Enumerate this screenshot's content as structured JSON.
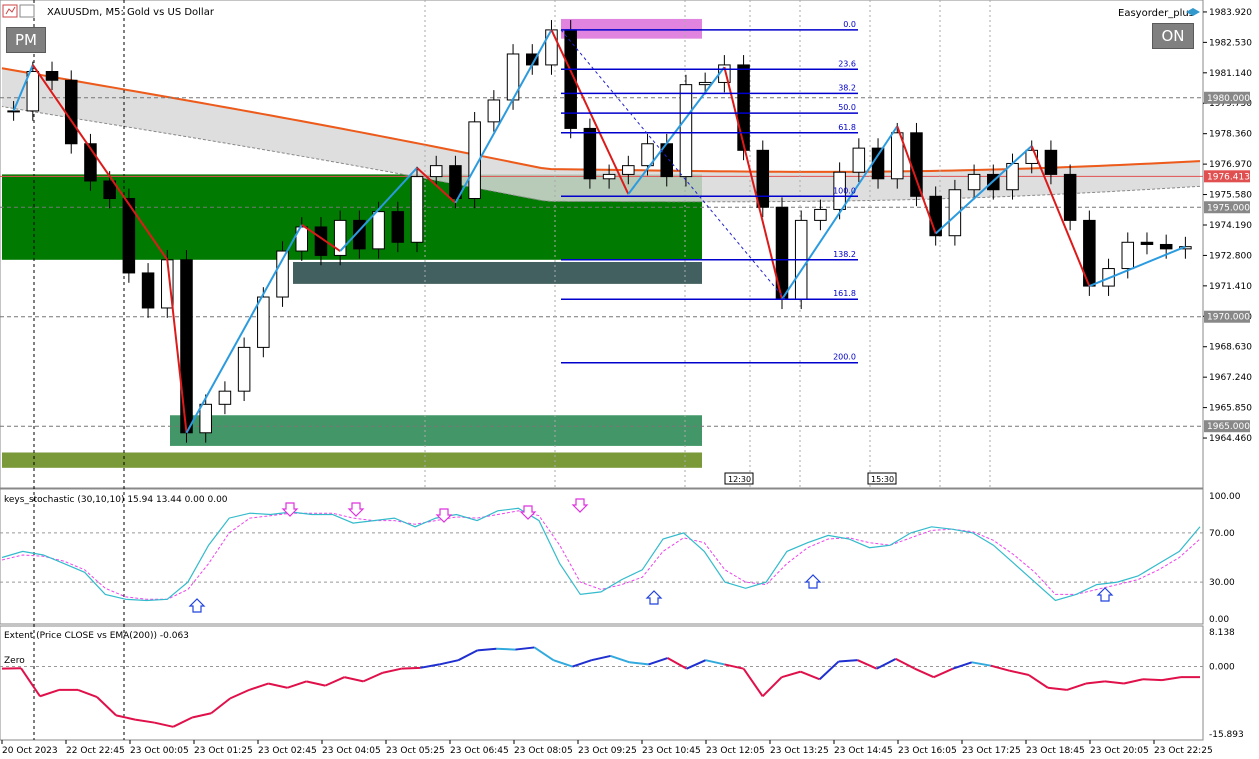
{
  "header": {
    "title": "XAUUSDm, M5:  Gold vs US Dollar",
    "ea_name": "Easyorder_plus"
  },
  "buttons": {
    "pm": "PM",
    "on": "ON"
  },
  "panels": {
    "stochastic_label": "keys_stochastic (30,10,10) 15.94 13.44 0.00 0.00",
    "extent_label": "Extent (Price CLOSE vs EMA(200)) -0.063",
    "zero_label": "Zero"
  },
  "chart_data": [
    {
      "type": "candlestick",
      "title": "XAUUSDm, M5:  Gold vs US Dollar",
      "ylim": [
        1963.0,
        1984.1
      ],
      "y_ticks": [
        "1983.920",
        "1982.530",
        "1981.140",
        "1979.750",
        "1978.360",
        "1976.970",
        "1975.580",
        "1974.190",
        "1972.800",
        "1971.410",
        "1970.020",
        "1968.630",
        "1967.240",
        "1965.850",
        "1964.460"
      ],
      "price_tags": [
        {
          "label": "1980.000",
          "value": 1980.0
        },
        {
          "label": "1976.413",
          "value": 1976.413,
          "color": "#e05050"
        },
        {
          "label": "1975.000",
          "value": 1975.0
        },
        {
          "label": "1970.000",
          "value": 1970.0
        },
        {
          "label": "1965.000",
          "value": 1965.0
        }
      ],
      "x_ticks": [
        "20 Oct 2023",
        "22 Oct 22:45",
        "23 Oct 00:05",
        "23 Oct 01:25",
        "23 Oct 02:45",
        "23 Oct 04:05",
        "23 Oct 05:25",
        "23 Oct 06:45",
        "23 Oct 08:05",
        "23 Oct 09:25",
        "23 Oct 10:45",
        "23 Oct 12:05",
        "23 Oct 13:25",
        "23 Oct 14:45",
        "23 Oct 16:05",
        "23 Oct 17:25",
        "23 Oct 18:45",
        "23 Oct 20:05",
        "23 Oct 22:25"
      ],
      "time_markers": [
        "12:30",
        "15:30"
      ],
      "fibonacci": [
        {
          "level": "0.0",
          "price": 1983.1
        },
        {
          "level": "23.6",
          "price": 1981.3
        },
        {
          "level": "38.2",
          "price": 1980.2
        },
        {
          "level": "50.0",
          "price": 1979.3
        },
        {
          "level": "61.8",
          "price": 1978.4
        },
        {
          "level": "100.0",
          "price": 1975.5
        },
        {
          "level": "138.2",
          "price": 1972.6
        },
        {
          "level": "161.8",
          "price": 1970.8
        },
        {
          "level": "200.0",
          "price": 1967.9
        }
      ],
      "zones": [
        {
          "name": "supply-zone",
          "from": 1982.7,
          "to": 1983.6,
          "color": "#dd77dd"
        },
        {
          "name": "demand-zone-main",
          "from": 1972.6,
          "to": 1976.5,
          "color": "#007a00"
        },
        {
          "name": "gap-zone",
          "from": 1971.5,
          "to": 1972.5,
          "color": "#2f4f4f"
        },
        {
          "name": "demand-zone-low",
          "from": 1964.1,
          "to": 1965.5,
          "color": "#2e8b57"
        },
        {
          "name": "base-zone",
          "from": 1963.1,
          "to": 1963.8,
          "color": "#6b8e23"
        }
      ],
      "series": [
        {
          "name": "close",
          "values": [
            1979.4,
            1981.2,
            1980.8,
            1977.9,
            1976.2,
            1975.4,
            1972.0,
            1970.4,
            1972.6,
            1964.7,
            1966.0,
            1966.6,
            1968.6,
            1970.9,
            1973.0,
            1974.1,
            1972.8,
            1974.4,
            1973.1,
            1974.8,
            1973.4,
            1976.4,
            1976.9,
            1975.4,
            1978.9,
            1979.9,
            1982.0,
            1981.5,
            1983.1,
            1978.6,
            1976.3,
            1976.5,
            1976.9,
            1977.9,
            1976.4,
            1980.6,
            1980.7,
            1981.5,
            1977.6,
            1975.0,
            1970.8,
            1974.4,
            1974.9,
            1976.6,
            1977.7,
            1976.3,
            1978.4,
            1975.5,
            1973.7,
            1975.8,
            1976.5,
            1975.8,
            1977.0,
            1977.6,
            1976.5,
            1974.4,
            1971.4,
            1972.2,
            1973.4,
            1973.3,
            1973.1,
            1973.2
          ]
        }
      ]
    },
    {
      "type": "line",
      "ylim": [
        0,
        100
      ],
      "y_ticks": [
        "100.00",
        "70.00",
        "30.00",
        "0.00"
      ],
      "series": [
        {
          "name": "main",
          "values": [
            50,
            55,
            52,
            45,
            38,
            20,
            16,
            15,
            16,
            30,
            60,
            82,
            86,
            85,
            87,
            85,
            85,
            78,
            80,
            82,
            75,
            82,
            85,
            80,
            88,
            90,
            80,
            45,
            20,
            22,
            32,
            40,
            65,
            70,
            55,
            30,
            25,
            30,
            55,
            62,
            68,
            65,
            58,
            60,
            70,
            75,
            73,
            70,
            60,
            45,
            30,
            15,
            20,
            28,
            30,
            35,
            45,
            55,
            75
          ]
        },
        {
          "name": "signal",
          "values": [
            48,
            52,
            51,
            47,
            40,
            25,
            18,
            16,
            16,
            24,
            45,
            70,
            82,
            84,
            86,
            86,
            86,
            82,
            80,
            80,
            77,
            80,
            83,
            82,
            85,
            88,
            84,
            60,
            30,
            24,
            28,
            34,
            55,
            66,
            62,
            40,
            30,
            28,
            45,
            58,
            65,
            66,
            62,
            60,
            66,
            72,
            73,
            71,
            64,
            52,
            38,
            20,
            20,
            24,
            28,
            32,
            40,
            50,
            65
          ]
        }
      ]
    },
    {
      "type": "line",
      "ylim": [
        -15.893,
        8.138
      ],
      "y_ticks": [
        "8.138",
        "0.000",
        "-15.893"
      ],
      "series": [
        {
          "name": "extent",
          "values": [
            -0.5,
            -0.4,
            -7.0,
            -5.5,
            -5.5,
            -7.2,
            -11.5,
            -12.5,
            -13.2,
            -14.2,
            -12.0,
            -11.0,
            -7.5,
            -5.5,
            -4.0,
            -5.0,
            -3.5,
            -4.5,
            -2.5,
            -3.5,
            -1.5,
            -0.5,
            -0.3,
            0.5,
            1.5,
            3.8,
            4.2,
            4.0,
            4.5,
            1.5,
            0.0,
            1.5,
            2.5,
            1.0,
            0.5,
            2.0,
            -0.5,
            1.5,
            0.5,
            -0.5,
            -7.0,
            -2.5,
            -1.2,
            -3.0,
            1.2,
            1.5,
            -0.5,
            1.8,
            -0.5,
            -2.5,
            -0.5,
            1.0,
            0.2,
            -1.0,
            -2.0,
            -5.0,
            -5.5,
            -4.0,
            -3.5,
            -4.0,
            -3.0,
            -3.2,
            -2.5,
            -2.5
          ]
        }
      ]
    }
  ]
}
